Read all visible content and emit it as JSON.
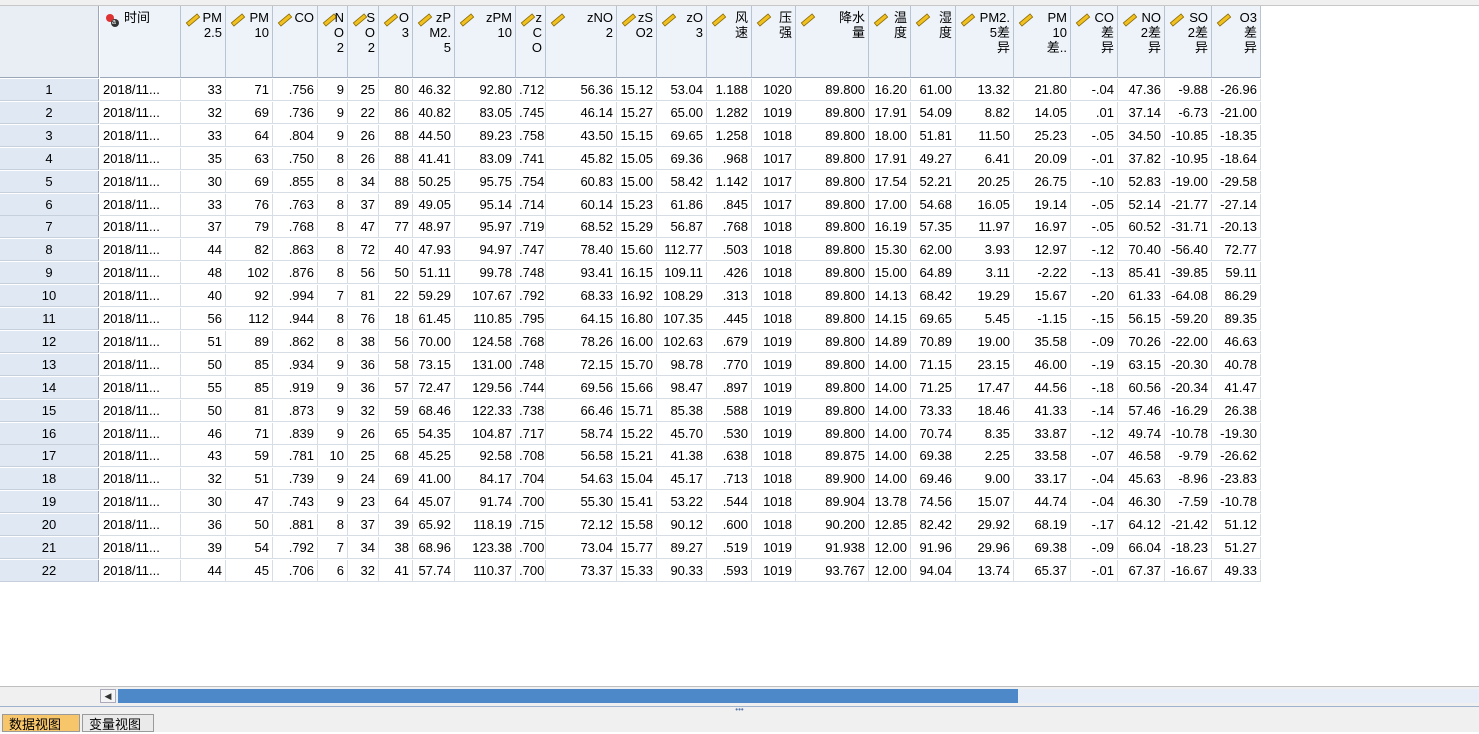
{
  "columns": [
    {
      "label": "时间",
      "icon": "string-variable-icon"
    },
    {
      "label": "PM\n2.5",
      "icon": "ruler-icon"
    },
    {
      "label": "PM\n10",
      "icon": "ruler-icon"
    },
    {
      "label": "CO",
      "icon": "ruler-icon"
    },
    {
      "label": "N\nO\n2",
      "icon": "ruler-icon"
    },
    {
      "label": "S\nO\n2",
      "icon": "ruler-icon"
    },
    {
      "label": "O\n3",
      "icon": "ruler-icon"
    },
    {
      "label": "zP\nM2.\n5",
      "icon": "ruler-icon"
    },
    {
      "label": "zPM\n10",
      "icon": "ruler-icon"
    },
    {
      "label": "z\nC\nO",
      "icon": "ruler-icon"
    },
    {
      "label": "zNO\n2",
      "icon": "ruler-icon"
    },
    {
      "label": "zS\nO2",
      "icon": "ruler-icon"
    },
    {
      "label": "zO\n3",
      "icon": "ruler-icon"
    },
    {
      "label": "风\n速",
      "icon": "ruler-icon"
    },
    {
      "label": "压\n强",
      "icon": "ruler-icon"
    },
    {
      "label": "降水\n量",
      "icon": "ruler-icon"
    },
    {
      "label": "温\n度",
      "icon": "ruler-icon"
    },
    {
      "label": "湿\n度",
      "icon": "ruler-icon"
    },
    {
      "label": "PM2.\n5差\n异",
      "icon": "ruler-icon"
    },
    {
      "label": "PM\n10\n差..",
      "icon": "ruler-icon"
    },
    {
      "label": "CO\n差\n异",
      "icon": "ruler-icon"
    },
    {
      "label": "NO\n2差\n异",
      "icon": "ruler-icon"
    },
    {
      "label": "SO\n2差\n异",
      "icon": "ruler-icon"
    },
    {
      "label": "O3\n差\n异",
      "icon": "ruler-icon"
    }
  ],
  "rows": [
    {
      "n": "1",
      "v": [
        "2018/11...",
        "33",
        "71",
        ".756",
        "9",
        "25",
        "80",
        "46.32",
        "92.80",
        ".712",
        "56.36",
        "15.12",
        "53.04",
        "1.188",
        "1020",
        "89.800",
        "16.20",
        "61.00",
        "13.32",
        "21.80",
        "-.04",
        "47.36",
        "-9.88",
        "-26.96"
      ]
    },
    {
      "n": "2",
      "v": [
        "2018/11...",
        "32",
        "69",
        ".736",
        "9",
        "22",
        "86",
        "40.82",
        "83.05",
        ".745",
        "46.14",
        "15.27",
        "65.00",
        "1.282",
        "1019",
        "89.800",
        "17.91",
        "54.09",
        "8.82",
        "14.05",
        ".01",
        "37.14",
        "-6.73",
        "-21.00"
      ]
    },
    {
      "n": "3",
      "v": [
        "2018/11...",
        "33",
        "64",
        ".804",
        "9",
        "26",
        "88",
        "44.50",
        "89.23",
        ".758",
        "43.50",
        "15.15",
        "69.65",
        "1.258",
        "1018",
        "89.800",
        "18.00",
        "51.81",
        "11.50",
        "25.23",
        "-.05",
        "34.50",
        "-10.85",
        "-18.35"
      ]
    },
    {
      "n": "4",
      "v": [
        "2018/11...",
        "35",
        "63",
        ".750",
        "8",
        "26",
        "88",
        "41.41",
        "83.09",
        ".741",
        "45.82",
        "15.05",
        "69.36",
        ".968",
        "1017",
        "89.800",
        "17.91",
        "49.27",
        "6.41",
        "20.09",
        "-.01",
        "37.82",
        "-10.95",
        "-18.64"
      ]
    },
    {
      "n": "5",
      "v": [
        "2018/11...",
        "30",
        "69",
        ".855",
        "8",
        "34",
        "88",
        "50.25",
        "95.75",
        ".754",
        "60.83",
        "15.00",
        "58.42",
        "1.142",
        "1017",
        "89.800",
        "17.54",
        "52.21",
        "20.25",
        "26.75",
        "-.10",
        "52.83",
        "-19.00",
        "-29.58"
      ]
    },
    {
      "n": "6",
      "v": [
        "2018/11...",
        "33",
        "76",
        ".763",
        "8",
        "37",
        "89",
        "49.05",
        "95.14",
        ".714",
        "60.14",
        "15.23",
        "61.86",
        ".845",
        "1017",
        "89.800",
        "17.00",
        "54.68",
        "16.05",
        "19.14",
        "-.05",
        "52.14",
        "-21.77",
        "-27.14"
      ]
    },
    {
      "n": "7",
      "v": [
        "2018/11...",
        "37",
        "79",
        ".768",
        "8",
        "47",
        "77",
        "48.97",
        "95.97",
        ".719",
        "68.52",
        "15.29",
        "56.87",
        ".768",
        "1018",
        "89.800",
        "16.19",
        "57.35",
        "11.97",
        "16.97",
        "-.05",
        "60.52",
        "-31.71",
        "-20.13"
      ]
    },
    {
      "n": "8",
      "v": [
        "2018/11...",
        "44",
        "82",
        ".863",
        "8",
        "72",
        "40",
        "47.93",
        "94.97",
        ".747",
        "78.40",
        "15.60",
        "112.77",
        ".503",
        "1018",
        "89.800",
        "15.30",
        "62.00",
        "3.93",
        "12.97",
        "-.12",
        "70.40",
        "-56.40",
        "72.77"
      ]
    },
    {
      "n": "9",
      "v": [
        "2018/11...",
        "48",
        "102",
        ".876",
        "8",
        "56",
        "50",
        "51.11",
        "99.78",
        ".748",
        "93.41",
        "16.15",
        "109.11",
        ".426",
        "1018",
        "89.800",
        "15.00",
        "64.89",
        "3.11",
        "-2.22",
        "-.13",
        "85.41",
        "-39.85",
        "59.11"
      ]
    },
    {
      "n": "10",
      "v": [
        "2018/11...",
        "40",
        "92",
        ".994",
        "7",
        "81",
        "22",
        "59.29",
        "107.67",
        ".792",
        "68.33",
        "16.92",
        "108.29",
        ".313",
        "1018",
        "89.800",
        "14.13",
        "68.42",
        "19.29",
        "15.67",
        "-.20",
        "61.33",
        "-64.08",
        "86.29"
      ]
    },
    {
      "n": "11",
      "v": [
        "2018/11...",
        "56",
        "112",
        ".944",
        "8",
        "76",
        "18",
        "61.45",
        "110.85",
        ".795",
        "64.15",
        "16.80",
        "107.35",
        ".445",
        "1018",
        "89.800",
        "14.15",
        "69.65",
        "5.45",
        "-1.15",
        "-.15",
        "56.15",
        "-59.20",
        "89.35"
      ]
    },
    {
      "n": "12",
      "v": [
        "2018/11...",
        "51",
        "89",
        ".862",
        "8",
        "38",
        "56",
        "70.00",
        "124.58",
        ".768",
        "78.26",
        "16.00",
        "102.63",
        ".679",
        "1019",
        "89.800",
        "14.89",
        "70.89",
        "19.00",
        "35.58",
        "-.09",
        "70.26",
        "-22.00",
        "46.63"
      ]
    },
    {
      "n": "13",
      "v": [
        "2018/11...",
        "50",
        "85",
        ".934",
        "9",
        "36",
        "58",
        "73.15",
        "131.00",
        ".748",
        "72.15",
        "15.70",
        "98.78",
        ".770",
        "1019",
        "89.800",
        "14.00",
        "71.15",
        "23.15",
        "46.00",
        "-.19",
        "63.15",
        "-20.30",
        "40.78"
      ]
    },
    {
      "n": "14",
      "v": [
        "2018/11...",
        "55",
        "85",
        ".919",
        "9",
        "36",
        "57",
        "72.47",
        "129.56",
        ".744",
        "69.56",
        "15.66",
        "98.47",
        ".897",
        "1019",
        "89.800",
        "14.00",
        "71.25",
        "17.47",
        "44.56",
        "-.18",
        "60.56",
        "-20.34",
        "41.47"
      ]
    },
    {
      "n": "15",
      "v": [
        "2018/11...",
        "50",
        "81",
        ".873",
        "9",
        "32",
        "59",
        "68.46",
        "122.33",
        ".738",
        "66.46",
        "15.71",
        "85.38",
        ".588",
        "1019",
        "89.800",
        "14.00",
        "73.33",
        "18.46",
        "41.33",
        "-.14",
        "57.46",
        "-16.29",
        "26.38"
      ]
    },
    {
      "n": "16",
      "v": [
        "2018/11...",
        "46",
        "71",
        ".839",
        "9",
        "26",
        "65",
        "54.35",
        "104.87",
        ".717",
        "58.74",
        "15.22",
        "45.70",
        ".530",
        "1019",
        "89.800",
        "14.00",
        "70.74",
        "8.35",
        "33.87",
        "-.12",
        "49.74",
        "-10.78",
        "-19.30"
      ]
    },
    {
      "n": "17",
      "v": [
        "2018/11...",
        "43",
        "59",
        ".781",
        "10",
        "25",
        "68",
        "45.25",
        "92.58",
        ".708",
        "56.58",
        "15.21",
        "41.38",
        ".638",
        "1018",
        "89.875",
        "14.00",
        "69.38",
        "2.25",
        "33.58",
        "-.07",
        "46.58",
        "-9.79",
        "-26.62"
      ]
    },
    {
      "n": "18",
      "v": [
        "2018/11...",
        "32",
        "51",
        ".739",
        "9",
        "24",
        "69",
        "41.00",
        "84.17",
        ".704",
        "54.63",
        "15.04",
        "45.17",
        ".713",
        "1018",
        "89.900",
        "14.00",
        "69.46",
        "9.00",
        "33.17",
        "-.04",
        "45.63",
        "-8.96",
        "-23.83"
      ]
    },
    {
      "n": "19",
      "v": [
        "2018/11...",
        "30",
        "47",
        ".743",
        "9",
        "23",
        "64",
        "45.07",
        "91.74",
        ".700",
        "55.30",
        "15.41",
        "53.22",
        ".544",
        "1018",
        "89.904",
        "13.78",
        "74.56",
        "15.07",
        "44.74",
        "-.04",
        "46.30",
        "-7.59",
        "-10.78"
      ]
    },
    {
      "n": "20",
      "v": [
        "2018/11...",
        "36",
        "50",
        ".881",
        "8",
        "37",
        "39",
        "65.92",
        "118.19",
        ".715",
        "72.12",
        "15.58",
        "90.12",
        ".600",
        "1018",
        "90.200",
        "12.85",
        "82.42",
        "29.92",
        "68.19",
        "-.17",
        "64.12",
        "-21.42",
        "51.12"
      ]
    },
    {
      "n": "21",
      "v": [
        "2018/11...",
        "39",
        "54",
        ".792",
        "7",
        "34",
        "38",
        "68.96",
        "123.38",
        ".700",
        "73.04",
        "15.77",
        "89.27",
        ".519",
        "1019",
        "91.938",
        "12.00",
        "91.96",
        "29.96",
        "69.38",
        "-.09",
        "66.04",
        "-18.23",
        "51.27"
      ]
    },
    {
      "n": "22",
      "v": [
        "2018/11...",
        "44",
        "45",
        ".706",
        "6",
        "32",
        "41",
        "57.74",
        "110.37",
        ".700",
        "73.37",
        "15.33",
        "90.33",
        ".593",
        "1019",
        "93.767",
        "12.00",
        "94.04",
        "13.74",
        "65.37",
        "-.01",
        "67.37",
        "-16.67",
        "49.33"
      ]
    }
  ],
  "tabs": {
    "data_view": "数据视图",
    "variable_view": "变量视图"
  }
}
